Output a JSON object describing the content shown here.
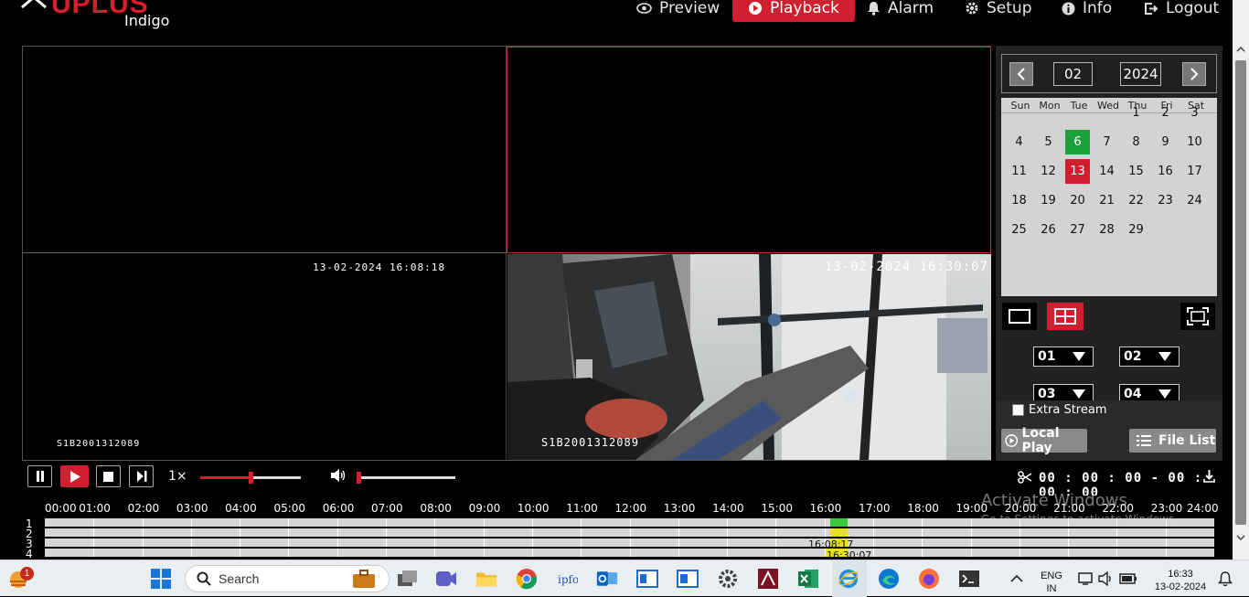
{
  "app": {
    "logo": "UPLUS",
    "logo_sub": "Indigo"
  },
  "nav": [
    {
      "label": "Preview",
      "icon": "eye-icon"
    },
    {
      "label": "Playback",
      "icon": "play-circle-icon",
      "active": true
    },
    {
      "label": "Alarm",
      "icon": "bell-icon"
    },
    {
      "label": "Setup",
      "icon": "gear-icon"
    },
    {
      "label": "Info",
      "icon": "info-icon"
    },
    {
      "label": "Logout",
      "icon": "logout-icon"
    }
  ],
  "cameras": [
    {
      "channel": "01",
      "timestamp": "",
      "serial": ""
    },
    {
      "channel": "02",
      "timestamp": "",
      "serial": ""
    },
    {
      "channel": "03",
      "timestamp": "13-02-2024 16:08:18",
      "serial": "S1B2001312089"
    },
    {
      "channel": "04",
      "timestamp": "13-02-2024 16:30:07",
      "serial": "S1B2001312089"
    }
  ],
  "calendar": {
    "month": "02",
    "year": "2024",
    "weekdays": [
      "Sun",
      "Mon",
      "Tue",
      "Wed",
      "Thu",
      "Fri",
      "Sat"
    ],
    "days": [
      "1",
      "2",
      "3",
      "4",
      "5",
      "6",
      "7",
      "8",
      "9",
      "10",
      "11",
      "12",
      "13",
      "14",
      "15",
      "16",
      "17",
      "18",
      "19",
      "20",
      "21",
      "22",
      "23",
      "24",
      "25",
      "26",
      "27",
      "28",
      "29"
    ],
    "first_weekday": 4,
    "record_day": "6",
    "selected_day": "13"
  },
  "channels": {
    "ch1": "01",
    "ch2": "02",
    "ch3": "03",
    "ch4": "04"
  },
  "extra_stream_label": "Extra Stream",
  "buttons": {
    "local_play": "Local Play",
    "file_list": "File List"
  },
  "playback": {
    "speed": "1×",
    "speed_position": 0.5,
    "volume_position": 0.0,
    "clip_time": "00 : 00 : 00 - 00 : 00 : 00"
  },
  "timeline": {
    "hours": [
      "00:00",
      "01:00",
      "02:00",
      "03:00",
      "04:00",
      "05:00",
      "06:00",
      "07:00",
      "08:00",
      "09:00",
      "10:00",
      "11:00",
      "12:00",
      "13:00",
      "14:00",
      "15:00",
      "16:00",
      "17:00",
      "18:00",
      "19:00",
      "20:00",
      "21:00",
      "22:00",
      "23:00",
      "24:00"
    ],
    "rows": [
      "1",
      "2",
      "3",
      "4"
    ],
    "label_row3": "16:08:17",
    "label_row4": "16:30:07"
  },
  "watermark": {
    "title": "Activate Windows",
    "sub": "Go to Settings to activate Windows."
  },
  "taskbar": {
    "weather_badge": "1",
    "search_placeholder": "Search",
    "lang": "ENG",
    "region": "IN",
    "time": "16:33",
    "date": "13-02-2024"
  },
  "colors": {
    "accent": "#d0202f",
    "record_green": "#1aa23a",
    "panel": "#222222"
  }
}
